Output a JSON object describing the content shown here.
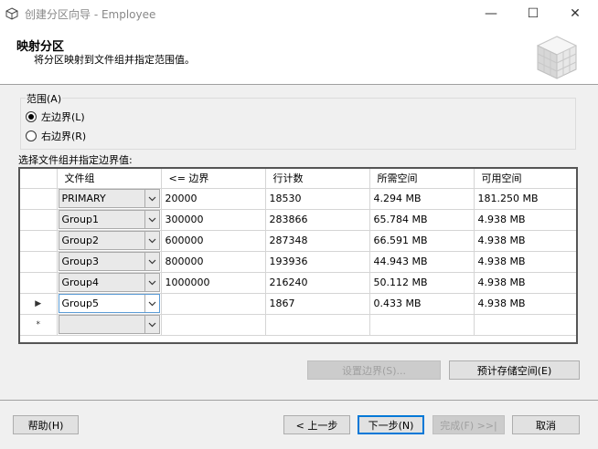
{
  "window": {
    "title": "创建分区向导 - Employee",
    "minimize": "—",
    "maximize": "☐",
    "close": "✕"
  },
  "header": {
    "title": "映射分区",
    "subtitle": "将分区映射到文件组并指定范围值。"
  },
  "range": {
    "legend": "范围(A)",
    "options": [
      {
        "label": "左边界(L)",
        "selected": true
      },
      {
        "label": "右边界(R)",
        "selected": false
      }
    ]
  },
  "grid": {
    "label": "选择文件组并指定边界值:",
    "columns": [
      "文件组",
      "<= 边界",
      "行计数",
      "所需空间",
      "可用空间"
    ],
    "rows": [
      {
        "filegroup": "PRIMARY",
        "boundary": "20000",
        "rows": "18530",
        "required": "4.294 MB",
        "available": "181.250 MB",
        "marker": ""
      },
      {
        "filegroup": "Group1",
        "boundary": "300000",
        "rows": "283866",
        "required": "65.784 MB",
        "available": "4.938 MB",
        "marker": ""
      },
      {
        "filegroup": "Group2",
        "boundary": "600000",
        "rows": "287348",
        "required": "66.591 MB",
        "available": "4.938 MB",
        "marker": ""
      },
      {
        "filegroup": "Group3",
        "boundary": "800000",
        "rows": "193936",
        "required": "44.943 MB",
        "available": "4.938 MB",
        "marker": ""
      },
      {
        "filegroup": "Group4",
        "boundary": "1000000",
        "rows": "216240",
        "required": "50.112 MB",
        "available": "4.938 MB",
        "marker": ""
      },
      {
        "filegroup": "Group5",
        "boundary": "",
        "rows": "1867",
        "required": "0.433 MB",
        "available": "4.938 MB",
        "marker": "▶"
      },
      {
        "filegroup": "",
        "boundary": "",
        "rows": "",
        "required": "",
        "available": "",
        "marker": "*"
      }
    ]
  },
  "actions": {
    "set_boundary": "设置边界(S)...",
    "estimate": "预计存储空间(E)"
  },
  "footer": {
    "help": "帮助(H)",
    "back": "< 上一步",
    "next": "下一步(N)",
    "finish": "完成(F) >>|",
    "cancel": "取消"
  },
  "colors": {
    "accent": "#0078d7",
    "header_bg": "#ffffff",
    "window_bg": "#f0f0f0"
  }
}
